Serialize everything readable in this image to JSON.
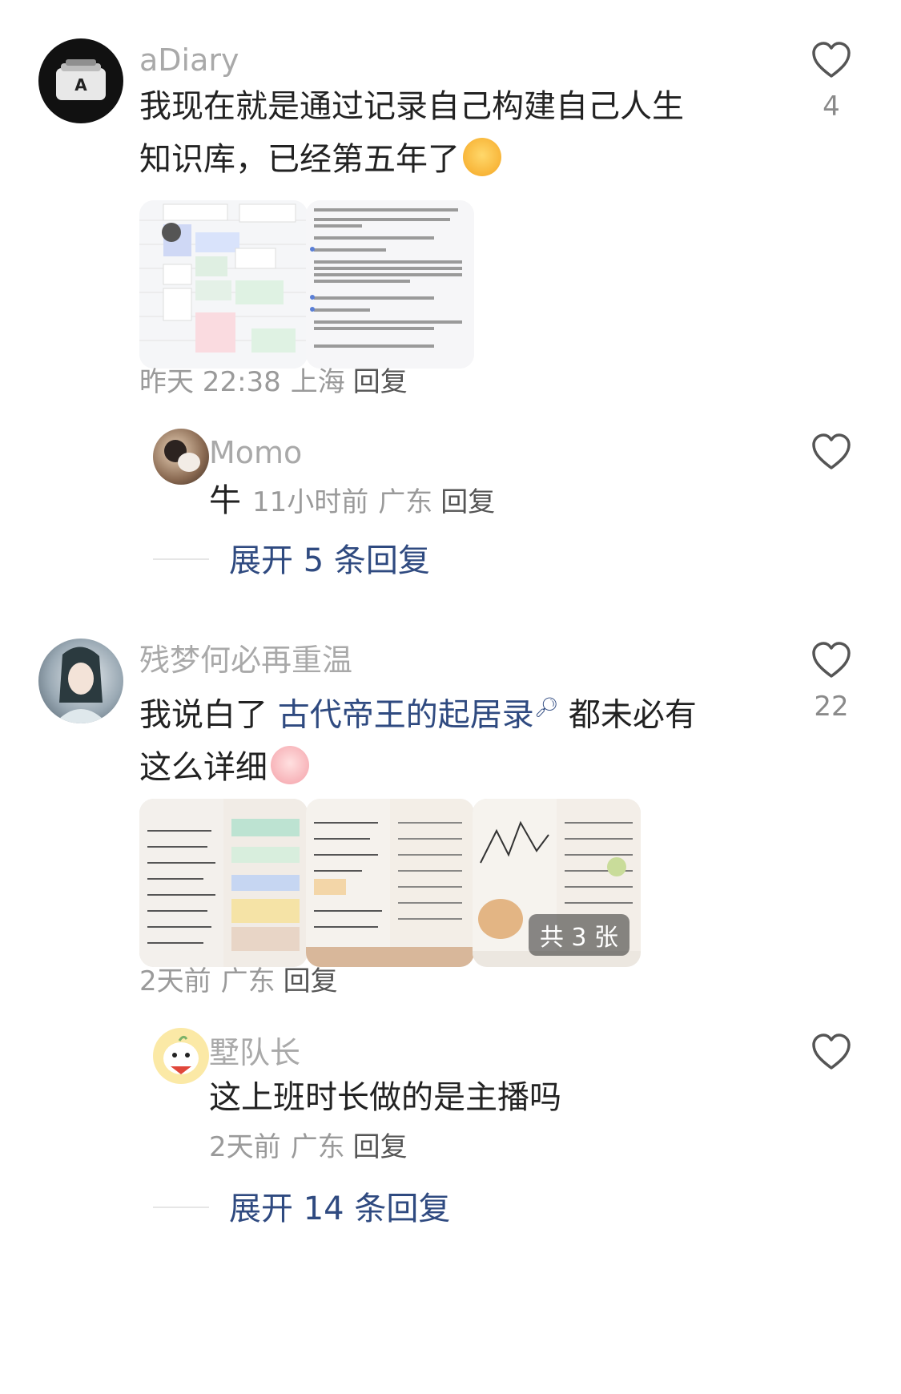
{
  "comments": [
    {
      "username": "aDiary",
      "text": "我现在就是通过记录自己构建自己人生知识库，已经第五年了",
      "meta_time": "昨天 22:38",
      "meta_location": "上海",
      "reply_label": "回复",
      "likes": "4",
      "images": [
        "calendar-screenshot",
        "ai-chat-screenshot"
      ],
      "replies": [
        {
          "username": "Momo",
          "text": "牛",
          "meta_time": "11小时前",
          "meta_location": "广东",
          "reply_label": "回复"
        }
      ],
      "expand_label": "展开 5 条回复"
    },
    {
      "username": "残梦何必再重温",
      "text_before": "我说白了 ",
      "link_text": "古代帝王的起居录",
      "text_after": " 都未必有这么详细",
      "meta_time": "2天前",
      "meta_location": "广东",
      "reply_label": "回复",
      "likes": "22",
      "images": [
        "notebook-photo-1",
        "notebook-photo-2",
        "notebook-photo-3"
      ],
      "images_badge": "共 3 张",
      "replies": [
        {
          "username": "墅队长",
          "text": "这上班时长做的是主播吗",
          "meta_time": "2天前",
          "meta_location": "广东",
          "reply_label": "回复"
        }
      ],
      "expand_label": "展开 14 条回复"
    }
  ],
  "colors": {
    "username": "#a9a9a9",
    "text": "#222222",
    "link": "#2f4a80",
    "meta": "#9a9a9a"
  }
}
